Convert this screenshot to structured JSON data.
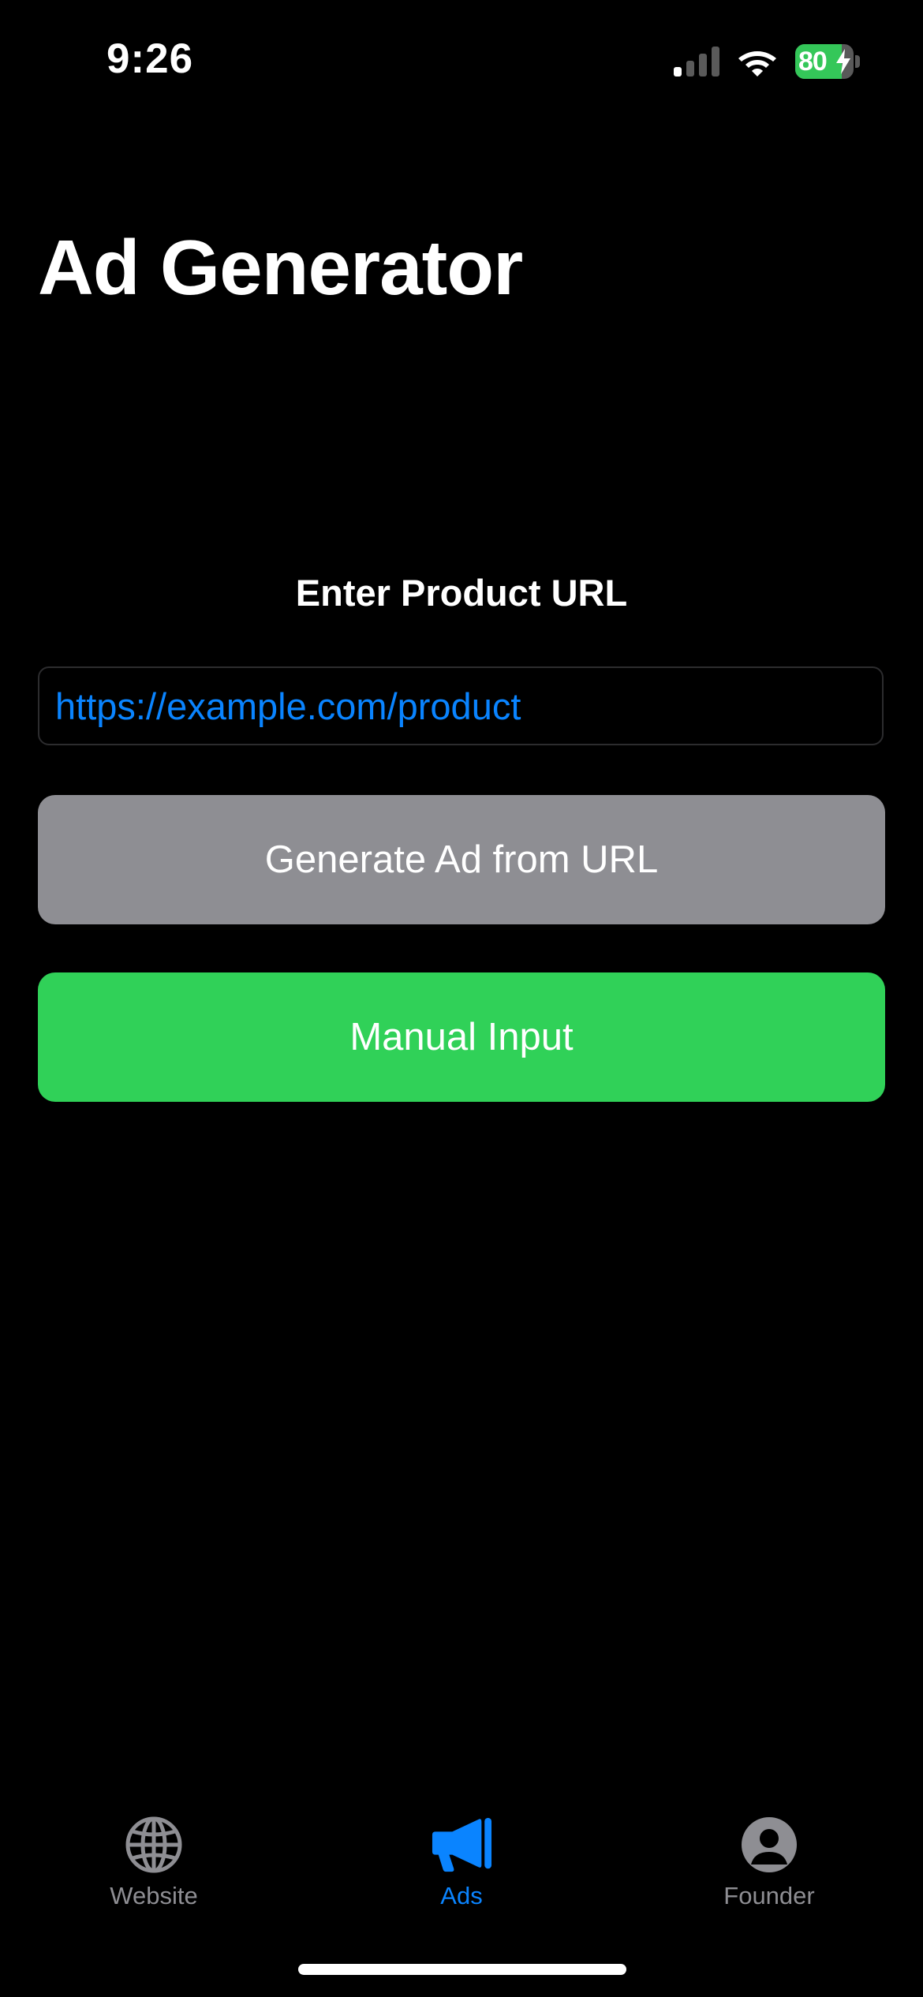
{
  "status_bar": {
    "time": "9:26",
    "battery_percent": "80",
    "battery_level": 0.8,
    "icons": [
      "cellular-signal-icon",
      "wifi-icon",
      "battery-charging-icon"
    ]
  },
  "header": {
    "title": "Ad Generator"
  },
  "form": {
    "label": "Enter Product URL",
    "url_placeholder": "https://example.com/product",
    "generate_button": "Generate Ad from URL",
    "manual_button": "Manual Input"
  },
  "tabs": [
    {
      "label": "Website",
      "icon": "globe-icon",
      "active": false
    },
    {
      "label": "Ads",
      "icon": "megaphone-icon",
      "active": true
    },
    {
      "label": "Founder",
      "icon": "person-circle-icon",
      "active": false
    }
  ],
  "colors": {
    "background": "#000000",
    "accent": "#0a84ff",
    "generate_button": "#8e8e93",
    "manual_button": "#30d158",
    "inactive_tab": "#8e8e93"
  }
}
